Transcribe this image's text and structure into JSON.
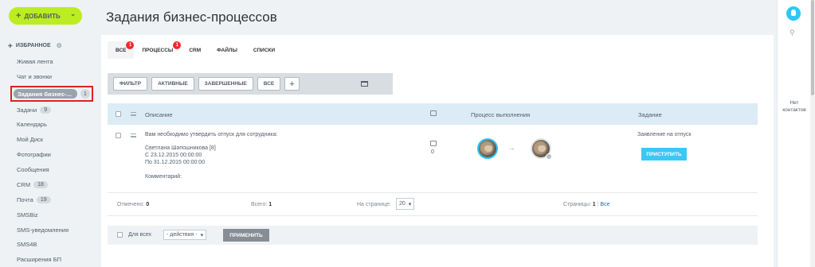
{
  "add_button": {
    "label": "ДОБАВИТЬ"
  },
  "sidebar": {
    "favorites_label": "ИЗБРАННОЕ",
    "items": [
      {
        "label": "Живая лента",
        "count": ""
      },
      {
        "label": "Чат и звонки",
        "count": ""
      },
      {
        "label": "Задания бизнес-...",
        "count": "1"
      },
      {
        "label": "Задачи",
        "count": "9"
      },
      {
        "label": "Календарь",
        "count": ""
      },
      {
        "label": "Мой Диск",
        "count": ""
      },
      {
        "label": "Фотографии",
        "count": ""
      },
      {
        "label": "Сообщения",
        "count": ""
      },
      {
        "label": "CRM",
        "count": "18"
      },
      {
        "label": "Почта",
        "count": "19"
      },
      {
        "label": "SMSBiz",
        "count": ""
      },
      {
        "label": "SMS-уведомления",
        "count": ""
      },
      {
        "label": "SMS4B",
        "count": ""
      },
      {
        "label": "Расширения БП",
        "count": ""
      }
    ]
  },
  "page_title": "Задания бизнес-процессов",
  "tabs": [
    {
      "label": "ВСЕ",
      "badge": "1"
    },
    {
      "label": "ПРОЦЕССЫ",
      "badge": "1"
    },
    {
      "label": "CRM",
      "badge": ""
    },
    {
      "label": "ФАЙЛЫ",
      "badge": ""
    },
    {
      "label": "СПИСКИ",
      "badge": ""
    }
  ],
  "filter_bar": {
    "filter": "ФИЛЬТР",
    "active": "АКТИВНЫЕ",
    "completed": "ЗАВЕРШЕННЫЕ",
    "all": "ВСЕ",
    "plus": "+"
  },
  "table": {
    "headers": {
      "description": "Описание",
      "progress": "Процесс выполнения",
      "task": "Задание"
    },
    "row": {
      "title": "Вам необходимо утвердить отпуск для сотрудника:",
      "employee": "Светлана Шапошникова [8]",
      "from": "С 23.12.2015 00:00:00",
      "to": "По 31.12.2015 00:00:00",
      "comment": "Комментарий:",
      "comments_count": "0",
      "task_name": "Заявление на отпуск",
      "start_button": "ПРИСТУПИТЬ"
    }
  },
  "footer": {
    "selected_label": "Отмечено:",
    "selected_value": "0",
    "total_label": "Всего:",
    "total_value": "1",
    "per_page_label": "На странице:",
    "per_page_value": "20",
    "pages_label": "Страницы:",
    "current_page": "1",
    "all_pages": "Все"
  },
  "action_bar": {
    "for_all": "Для всех",
    "action_select": "- действия -",
    "apply_button": "ПРИМЕНИТЬ"
  },
  "right_panel": {
    "no_contacts": "Нет контактов"
  },
  "colors": {
    "accent": "#2fc6f6",
    "add_button": "#bbed21",
    "badge": "#ee2c2c",
    "active_nav": "#9aa3ab",
    "highlight_border": "#e02020"
  }
}
